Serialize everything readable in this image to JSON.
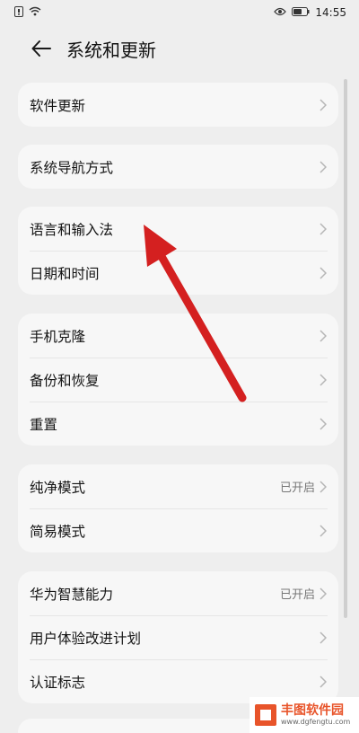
{
  "status_bar": {
    "time": "14:55",
    "icons": [
      "notification-icon",
      "wifi-icon",
      "eye-icon",
      "battery-icon"
    ]
  },
  "header": {
    "title": "系统和更新",
    "back_icon": "back-arrow-icon"
  },
  "groups": [
    {
      "items": [
        {
          "label": "软件更新"
        }
      ]
    },
    {
      "items": [
        {
          "label": "系统导航方式"
        }
      ]
    },
    {
      "items": [
        {
          "label": "语言和输入法"
        },
        {
          "label": "日期和时间"
        }
      ]
    },
    {
      "items": [
        {
          "label": "手机克隆"
        },
        {
          "label": "备份和恢复"
        },
        {
          "label": "重置"
        }
      ]
    },
    {
      "items": [
        {
          "label": "纯净模式",
          "value": "已开启"
        },
        {
          "label": "简易模式"
        }
      ]
    },
    {
      "items": [
        {
          "label": "华为智慧能力",
          "value": "已开启"
        },
        {
          "label": "用户体验改进计划"
        },
        {
          "label": "认证标志"
        }
      ]
    }
  ],
  "annotation": {
    "arrow_color": "#d42020"
  },
  "watermark": {
    "name": "丰图软件园",
    "url": "www.dgfengtu.com",
    "color": "#e8542a"
  }
}
